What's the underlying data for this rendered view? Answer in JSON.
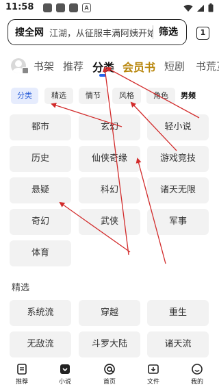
{
  "status": {
    "time": "11:58",
    "notif_icons": [
      "app-icon",
      "app-icon",
      "app-icon",
      "text-a-icon"
    ]
  },
  "search": {
    "scope": "搜全网",
    "query": "江湖，从征服丰满阿姨开始",
    "button": "筛选",
    "tab_count": "1"
  },
  "nav": {
    "tabs": [
      "书架",
      "推荐",
      "分类",
      "会员书",
      "短剧",
      "书荒互助"
    ],
    "active_tab": "分类"
  },
  "filters": {
    "chips": [
      "分类",
      "精选",
      "情节",
      "风格",
      "角色"
    ],
    "active_chip": "分类",
    "bold_chip": "男频"
  },
  "categories": [
    "都市",
    "玄幻",
    "轻小说",
    "历史",
    "仙侠奇缘",
    "游戏竞技",
    "悬疑",
    "科幻",
    "诸天无限",
    "奇幻",
    "武侠",
    "军事",
    "体育"
  ],
  "featured": {
    "title": "精选",
    "items": [
      "系统流",
      "穿越",
      "重生",
      "无敌流",
      "斗罗大陆",
      "诸天流"
    ]
  },
  "bottom_nav": [
    {
      "label": "推荐",
      "icon": "book-icon"
    },
    {
      "label": "小说",
      "icon": "novel-icon",
      "active": true
    },
    {
      "label": "首页",
      "icon": "home-at-icon"
    },
    {
      "label": "文件",
      "icon": "folder-icon"
    },
    {
      "label": "我的",
      "icon": "profile-icon"
    }
  ],
  "colors": {
    "accent": "#2563eb",
    "vip": "#b8860b",
    "arrow": "#d22b2b",
    "chip_bg": "#f2f2f2"
  }
}
